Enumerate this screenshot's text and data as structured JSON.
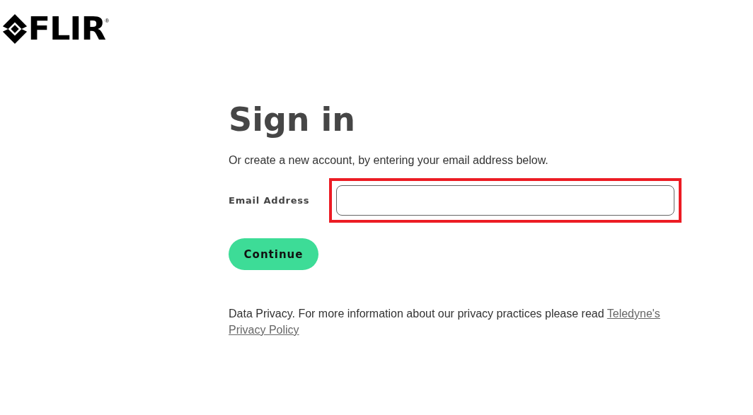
{
  "logo": {
    "text": "FLIR",
    "mark": "®"
  },
  "title": "Sign in",
  "subtitle": "Or create a new account, by entering your email address below.",
  "email": {
    "label": "Email Address",
    "highlighted": true
  },
  "continue_button": "Continue",
  "privacy": {
    "text": "Data Privacy. For more information about our privacy practices please read",
    "link_parts": [
      "Teledyne's",
      "Privacy Policy"
    ]
  }
}
